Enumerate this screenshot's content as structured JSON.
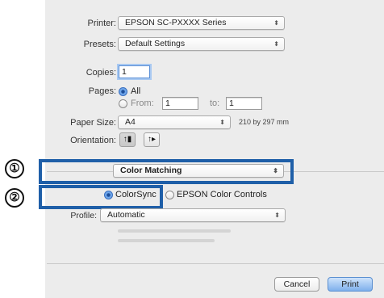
{
  "printer": {
    "label": "Printer:",
    "value": "EPSON SC-PXXXX Series"
  },
  "presets": {
    "label": "Presets:",
    "value": "Default Settings"
  },
  "copies": {
    "label": "Copies:",
    "value": "1"
  },
  "pages": {
    "label": "Pages:",
    "all_label": "All",
    "from_label": "From:",
    "from_value": "1",
    "to_label": "to:",
    "to_value": "1"
  },
  "paper_size": {
    "label": "Paper Size:",
    "value": "A4",
    "dimensions": "210 by 297 mm"
  },
  "orientation": {
    "label": "Orientation:"
  },
  "section_popup": {
    "value": "Color Matching"
  },
  "color_options": {
    "colorsync": "ColorSync",
    "epson": "EPSON Color Controls",
    "selected": "ColorSync"
  },
  "profile": {
    "label": "Profile:",
    "value": "Automatic"
  },
  "buttons": {
    "cancel": "Cancel",
    "print": "Print"
  },
  "callouts": {
    "one": "①",
    "two": "②"
  },
  "colors": {
    "highlight": "#1f5fa8",
    "dialog_bg": "#ececec"
  },
  "icons": {
    "popup_arrows": "updown-arrows-icon",
    "portrait": "portrait-orientation-icon",
    "landscape": "landscape-orientation-icon"
  }
}
